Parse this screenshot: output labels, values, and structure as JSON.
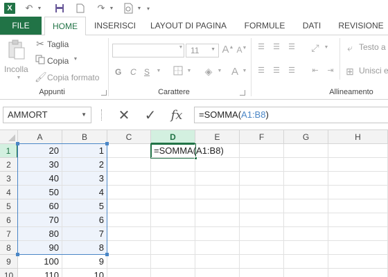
{
  "app": {
    "logo": "X"
  },
  "quick_access": [
    "excel-logo",
    "undo-icon",
    "save-icon",
    "new-doc-icon",
    "redo-icon",
    "print-preview-icon",
    "customize-icon"
  ],
  "tabs": [
    {
      "label": "FILE",
      "active": false
    },
    {
      "label": "HOME",
      "active": true
    },
    {
      "label": "INSERISCI",
      "active": false
    },
    {
      "label": "LAYOUT DI PAGINA",
      "active": false
    },
    {
      "label": "FORMULE",
      "active": false
    },
    {
      "label": "DATI",
      "active": false
    },
    {
      "label": "REVISIONE",
      "active": false
    }
  ],
  "ribbon": {
    "clipboard": {
      "paste_label": "Incolla",
      "cut_label": "Taglia",
      "copy_label": "Copia",
      "format_painter_label": "Copia formato",
      "group_label": "Appunti"
    },
    "font": {
      "font_size": "11",
      "bold": "G",
      "italic": "C",
      "underline": "S",
      "group_label": "Carattere"
    },
    "alignment": {
      "wrap_label": "Testo a",
      "merge_label": "Unisci e",
      "group_label": "Allineamento"
    }
  },
  "formula_bar": {
    "name_box": "AMMORT",
    "cancel_symbol": "✕",
    "enter_symbol": "✓",
    "fx_symbol": "fx",
    "formula_prefix": "=SOMMA(",
    "formula_ref": "A1:B8",
    "formula_suffix": ")"
  },
  "grid": {
    "columns": [
      "A",
      "B",
      "C",
      "D",
      "E",
      "F",
      "G",
      "H"
    ],
    "selected_column": "D",
    "rows": [
      {
        "num": "1",
        "A": "20",
        "B": "1",
        "D": "=SOMMA(A1:B8)"
      },
      {
        "num": "2",
        "A": "30",
        "B": "2"
      },
      {
        "num": "3",
        "A": "40",
        "B": "3"
      },
      {
        "num": "4",
        "A": "50",
        "B": "4"
      },
      {
        "num": "5",
        "A": "60",
        "B": "5"
      },
      {
        "num": "6",
        "A": "70",
        "B": "6"
      },
      {
        "num": "7",
        "A": "80",
        "B": "7"
      },
      {
        "num": "8",
        "A": "90",
        "B": "8"
      },
      {
        "num": "9",
        "A": "100",
        "B": "9"
      },
      {
        "num": "10",
        "A": "110",
        "B": "10"
      }
    ],
    "selected_row": "1"
  },
  "colors": {
    "excel_green": "#217346",
    "range_blue": "#4a86c6"
  }
}
